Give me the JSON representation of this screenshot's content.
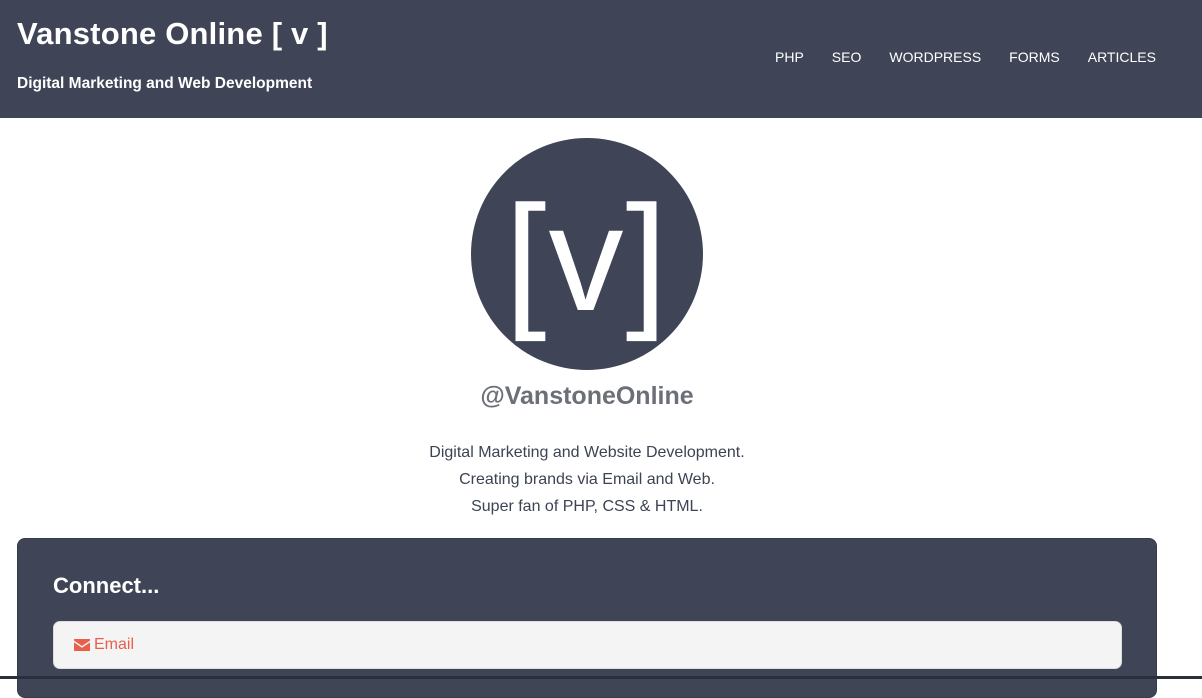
{
  "header": {
    "site_title": "Vanstone Online [ v ]",
    "tagline": "Digital Marketing and Web Development",
    "nav": [
      "PHP",
      "SEO",
      "WORDPRESS",
      "FORMS",
      "ARTICLES"
    ]
  },
  "profile": {
    "avatar_text": "[v]",
    "handle": "@VanstoneOnline",
    "bio": [
      "Digital Marketing and Website Development.",
      "Creating brands via Email and Web.",
      "Super fan of PHP, CSS & HTML."
    ]
  },
  "connect": {
    "title": "Connect...",
    "email_icon": "envelope-icon",
    "email_label": "Email"
  },
  "colors": {
    "header_bg": "#3f4556",
    "accent": "#e8604c",
    "panel_bg": "#3f4556"
  }
}
